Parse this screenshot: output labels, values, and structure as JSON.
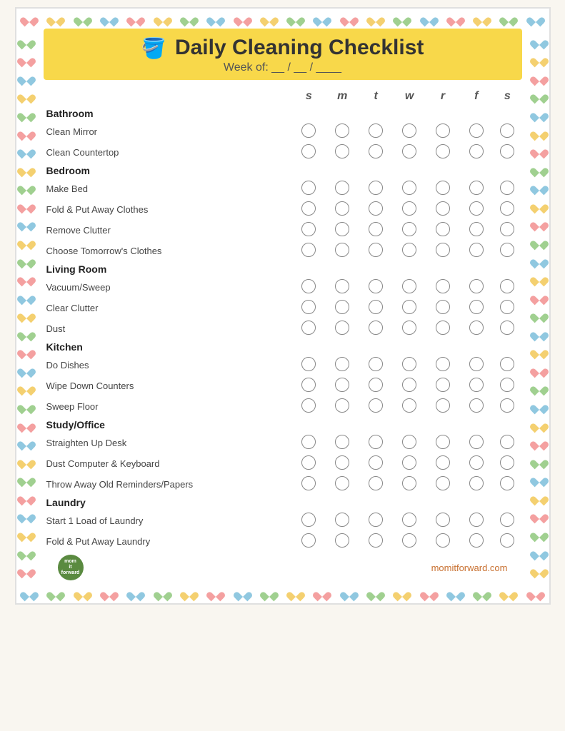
{
  "header": {
    "title": "Daily Cleaning Checklist",
    "week_label": "Week of:",
    "week_blank": "__ / __ / ____",
    "icon": "🪣"
  },
  "days": {
    "headers": [
      "s",
      "m",
      "t",
      "w",
      "r",
      "f",
      "s"
    ]
  },
  "sections": [
    {
      "category": "Bathroom",
      "tasks": [
        "Clean Mirror",
        "Clean Countertop"
      ]
    },
    {
      "category": "Bedroom",
      "tasks": [
        "Make Bed",
        "Fold & Put Away Clothes",
        "Remove Clutter",
        "Choose Tomorrow's Clothes"
      ]
    },
    {
      "category": "Living Room",
      "tasks": [
        "Vacuum/Sweep",
        "Clear Clutter",
        "Dust"
      ]
    },
    {
      "category": "Kitchen",
      "tasks": [
        "Do Dishes",
        "Wipe Down Counters",
        "Sweep Floor"
      ]
    },
    {
      "category": "Study/Office",
      "tasks": [
        "Straighten Up Desk",
        "Dust Computer & Keyboard",
        "Throw Away Old Reminders/Papers"
      ]
    },
    {
      "category": "Laundry",
      "tasks": [
        "Start 1 Load of Laundry",
        "Fold & Put Away Laundry"
      ]
    }
  ],
  "footer": {
    "logo_line1": "mom",
    "logo_line2": "it",
    "logo_line3": "forward",
    "website": "momitforward.com"
  },
  "border_hearts": {
    "colors": [
      "pink",
      "yellow",
      "green",
      "blue",
      "pink",
      "yellow",
      "green",
      "blue",
      "pink",
      "yellow",
      "green",
      "blue",
      "pink",
      "yellow",
      "green",
      "blue",
      "pink",
      "yellow",
      "green"
    ]
  }
}
